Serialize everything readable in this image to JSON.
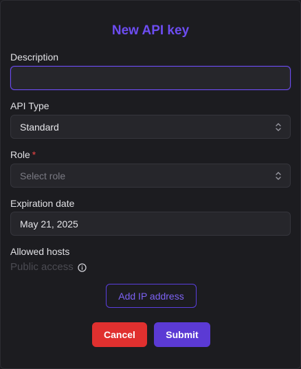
{
  "dialog": {
    "title": "New API key"
  },
  "description": {
    "label": "Description",
    "value": "",
    "placeholder": ""
  },
  "api_type": {
    "label": "API Type",
    "selected": "Standard"
  },
  "role": {
    "label": "Role",
    "required_marker": "*",
    "placeholder": "Select role"
  },
  "expiration": {
    "label": "Expiration date",
    "value": "May 21, 2025"
  },
  "allowed_hosts": {
    "label": "Allowed hosts",
    "status": "Public access",
    "add_button": "Add IP address"
  },
  "actions": {
    "cancel": "Cancel",
    "submit": "Submit"
  },
  "colors": {
    "accent": "#6d4df2",
    "cancel": "#e0302f",
    "submit": "#5b3ad4",
    "background": "#1c1c20"
  }
}
